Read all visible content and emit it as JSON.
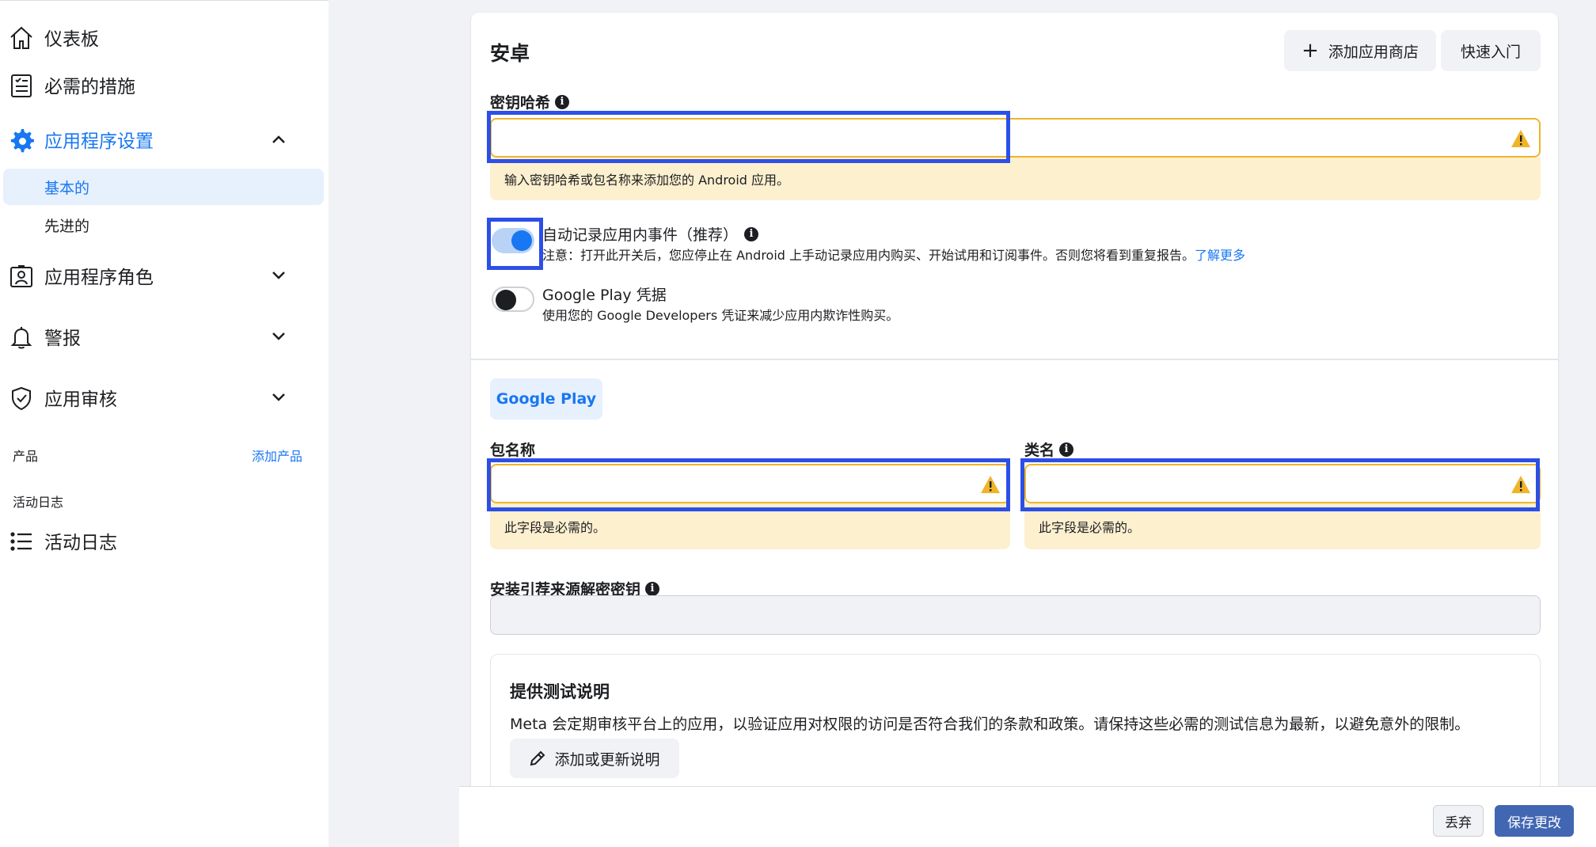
{
  "sidebar": {
    "items": [
      {
        "label": "仪表板",
        "icon": "home-icon"
      },
      {
        "label": "必需的措施",
        "icon": "checklist-icon"
      },
      {
        "label": "应用程序设置",
        "icon": "gear-icon"
      },
      {
        "label": "应用程序角色",
        "icon": "roles-icon"
      },
      {
        "label": "警报",
        "icon": "bell-icon"
      },
      {
        "label": "应用审核",
        "icon": "shield-check-icon"
      }
    ],
    "subitems": [
      {
        "label": "基本的"
      },
      {
        "label": "先进的"
      }
    ],
    "products_label": "产品",
    "add_product_link": "添加产品",
    "activity_section_label": "活动日志",
    "activity_item": {
      "label": "活动日志",
      "icon": "list-icon"
    }
  },
  "android": {
    "title": "安卓",
    "add_store_button": "添加应用商店",
    "quickstart_button": "快速入门",
    "key_hash_label": "密钥哈希",
    "key_hash_value": "",
    "key_hash_warning": "输入密钥哈希或包名称来添加您的 Android 应用。",
    "auto_log": {
      "title": "自动记录应用内事件（推荐）",
      "desc": "注意：打开此开关后，您应停止在 Android 上手动记录应用内购买、开始试用和订阅事件。否则您将看到重复报告。",
      "link": "了解更多",
      "enabled": true
    },
    "google_play_cred": {
      "title": "Google Play 凭据",
      "desc": "使用您的 Google Developers 凭证来减少应用内欺诈性购买。",
      "enabled": false
    }
  },
  "google_play": {
    "tab_label": "Google Play",
    "package_label": "包名称",
    "package_value": "",
    "package_warning": "此字段是必需的。",
    "class_label": "类名",
    "class_value": "",
    "class_warning": "此字段是必需的。",
    "install_referrer_label": "安装引荐来源解密密钥",
    "install_referrer_value": ""
  },
  "test_instructions": {
    "title": "提供测试说明",
    "desc": "Meta 会定期审核平台上的应用，以验证应用对权限的访问是否符合我们的条款和政策。请保持这些必需的测试信息为最新，以避免意外的限制。",
    "button": "添加或更新说明"
  },
  "footer": {
    "discard": "丢弃",
    "save": "保存更改"
  },
  "colors": {
    "accent": "#1877f2",
    "warning": "#f0b429",
    "warning_bg": "#fdf0cf",
    "highlight": "#2c4fe6",
    "save_button": "#4267b2"
  }
}
